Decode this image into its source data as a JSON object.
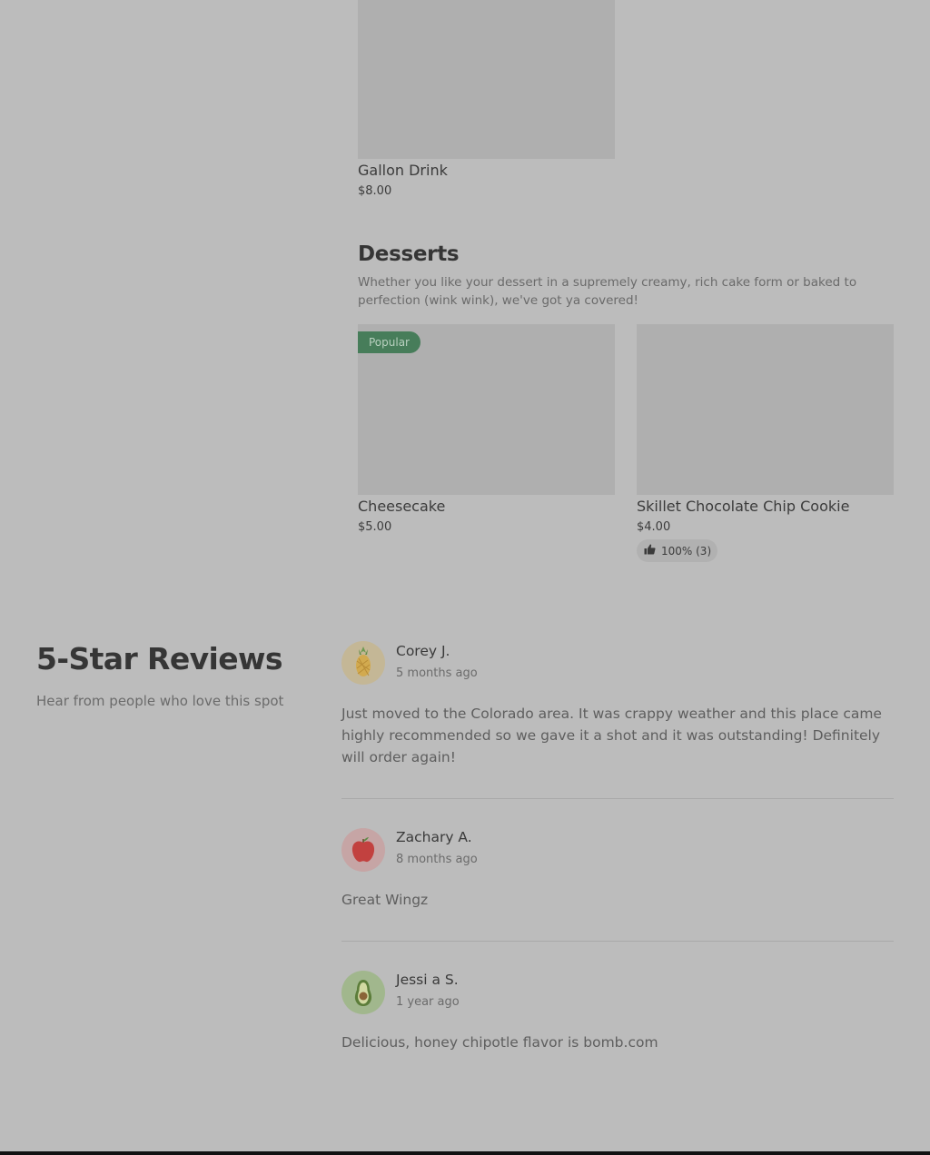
{
  "menu": {
    "drinks_items": [
      {
        "name": "Gallon Drink",
        "price": "$8.00"
      }
    ],
    "desserts": {
      "title": "Desserts",
      "description": "Whether you like your dessert in a supremely creamy, rich cake form or baked to perfection (wink wink), we've got ya covered!",
      "items": [
        {
          "name": "Cheesecake",
          "price": "$5.00",
          "badge": "Popular"
        },
        {
          "name": "Skillet Chocolate Chip Cookie",
          "price": "$4.00",
          "rating": "100% (3)",
          "rating_icon": "thumbs-up-icon"
        }
      ]
    }
  },
  "reviews": {
    "title": "5-Star Reviews",
    "subtitle": "Hear from people who love this spot",
    "items": [
      {
        "name": "Corey J.",
        "date": "5 months ago",
        "avatar_icon": "pineapple-icon",
        "text": "Just moved to the Colorado area. It was crappy weather and this place came highly recommended so we gave it a shot and it was outstanding! Definitely will order again!"
      },
      {
        "name": "Zachary A.",
        "date": "8 months ago",
        "avatar_icon": "apple-icon",
        "text": "Great Wingz"
      },
      {
        "name": "Jessi a S.",
        "date": "1 year ago",
        "avatar_icon": "avocado-icon",
        "text": "Delicious, honey chipotle flavor is bomb.com"
      }
    ]
  },
  "colors": {
    "overlay_background": "#bcbcbc",
    "image_placeholder": "#afafaf",
    "popular_badge": "#477d5a"
  }
}
